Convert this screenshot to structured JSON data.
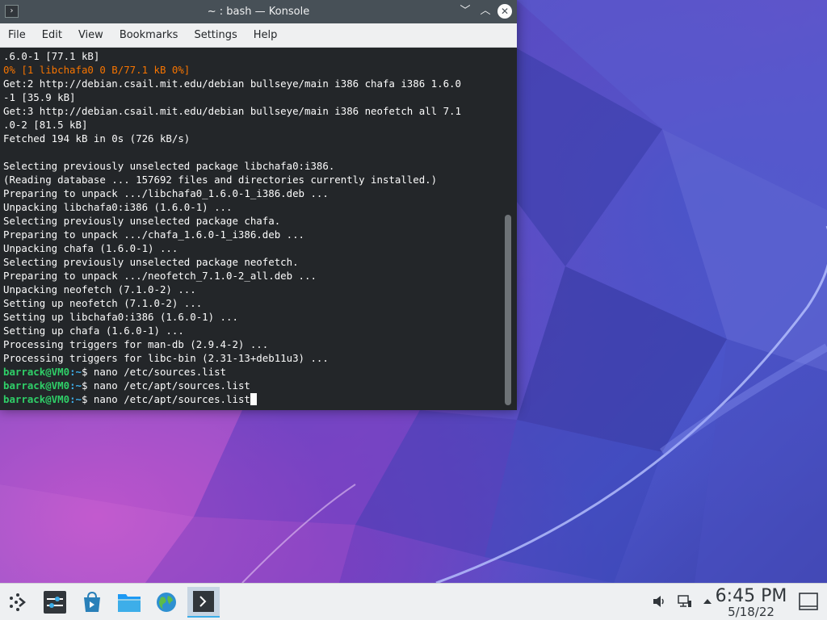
{
  "window": {
    "title": "~ : bash — Konsole",
    "icon": "terminal-icon",
    "controls": {
      "minimize": "﹀",
      "maximize": "︿",
      "close": "✕"
    }
  },
  "menubar": {
    "items": [
      "File",
      "Edit",
      "View",
      "Bookmarks",
      "Settings",
      "Help"
    ]
  },
  "terminal": {
    "lines": [
      {
        "text": ".6.0-1 [77.1 kB]",
        "style": "normal"
      },
      {
        "text": "0% [1 libchafa0 0 B/77.1 kB 0%]",
        "style": "orange"
      },
      {
        "text": "Get:2 http://debian.csail.mit.edu/debian bullseye/main i386 chafa i386 1.6.0",
        "style": "normal"
      },
      {
        "text": "-1 [35.9 kB]",
        "style": "normal"
      },
      {
        "text": "Get:3 http://debian.csail.mit.edu/debian bullseye/main i386 neofetch all 7.1",
        "style": "normal"
      },
      {
        "text": ".0-2 [81.5 kB]",
        "style": "normal"
      },
      {
        "text": "Fetched 194 kB in 0s (726 kB/s)",
        "style": "normal"
      },
      {
        "text": "",
        "style": "normal"
      },
      {
        "text": "Selecting previously unselected package libchafa0:i386.",
        "style": "normal"
      },
      {
        "text": "(Reading database ... 157692 files and directories currently installed.)",
        "style": "normal"
      },
      {
        "text": "Preparing to unpack .../libchafa0_1.6.0-1_i386.deb ...",
        "style": "normal"
      },
      {
        "text": "Unpacking libchafa0:i386 (1.6.0-1) ...",
        "style": "normal"
      },
      {
        "text": "Selecting previously unselected package chafa.",
        "style": "normal"
      },
      {
        "text": "Preparing to unpack .../chafa_1.6.0-1_i386.deb ...",
        "style": "normal"
      },
      {
        "text": "Unpacking chafa (1.6.0-1) ...",
        "style": "normal"
      },
      {
        "text": "Selecting previously unselected package neofetch.",
        "style": "normal"
      },
      {
        "text": "Preparing to unpack .../neofetch_7.1.0-2_all.deb ...",
        "style": "normal"
      },
      {
        "text": "Unpacking neofetch (7.1.0-2) ...",
        "style": "normal"
      },
      {
        "text": "Setting up neofetch (7.1.0-2) ...",
        "style": "normal"
      },
      {
        "text": "Setting up libchafa0:i386 (1.6.0-1) ...",
        "style": "normal"
      },
      {
        "text": "Setting up chafa (1.6.0-1) ...",
        "style": "normal"
      },
      {
        "text": "Processing triggers for man-db (2.9.4-2) ...",
        "style": "normal"
      },
      {
        "text": "Processing triggers for libc-bin (2.31-13+deb11u3) ...",
        "style": "normal"
      }
    ],
    "prompts": [
      {
        "user": "barrack@VM0",
        "path": ":~",
        "symbol": "$ ",
        "command": "nano /etc/sources.list"
      },
      {
        "user": "barrack@VM0",
        "path": ":~",
        "symbol": "$ ",
        "command": "nano /etc/apt/sources.list"
      },
      {
        "user": "barrack@VM0",
        "path": ":~",
        "symbol": "$ ",
        "command": "nano /etc/apt/sources.list"
      }
    ],
    "colors": {
      "background": "#232629",
      "text": "#fcfcfc",
      "user": "#2fcf68",
      "path": "#3daee9",
      "warning": "#f67400"
    }
  },
  "taskbar": {
    "launcher_icon": "application-launcher-icon",
    "tasks": [
      {
        "name": "system-settings-icon"
      },
      {
        "name": "discover-store-icon"
      },
      {
        "name": "dolphin-file-manager-icon"
      },
      {
        "name": "web-browser-globe-icon"
      },
      {
        "name": "konsole-terminal-icon",
        "active": true
      }
    ],
    "tray": [
      {
        "name": "volume-icon",
        "glyph": "🔈"
      },
      {
        "name": "network-icon",
        "glyph": "🖧"
      },
      {
        "name": "tray-expand-icon",
        "glyph": "▲"
      }
    ],
    "clock": {
      "time": "6:45 PM",
      "date": "5/18/22"
    },
    "show_desktop_icon": "show-desktop-icon"
  }
}
